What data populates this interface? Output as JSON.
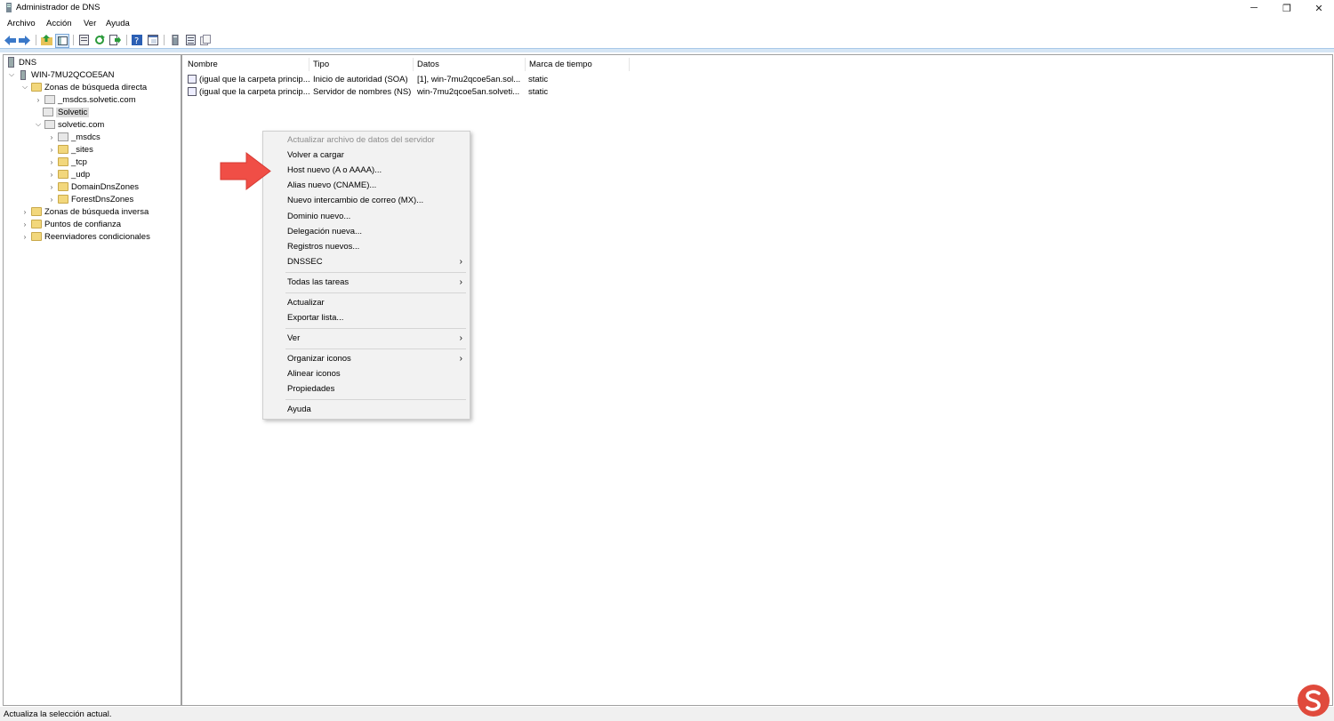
{
  "window": {
    "title": "Administrador de DNS",
    "controls": {
      "minimize": "─",
      "restore": "❐",
      "close": "✕"
    }
  },
  "menu": [
    "Archivo",
    "Acción",
    "Ver",
    "Ayuda"
  ],
  "toolbar": {
    "buttons": [
      "back-icon",
      "forward-icon",
      "up-folder-icon",
      "show-tree-icon",
      "properties-icon",
      "refresh-icon",
      "export-icon",
      "help-icon",
      "console-icon",
      "server-icon",
      "list-icon",
      "records-icon"
    ]
  },
  "tree": {
    "root": "DNS",
    "server": "WIN-7MU2QCOE5AN",
    "forward_zones": "Zonas de búsqueda directa",
    "msdcs_zone": "_msdcs.solvetic.com",
    "solvetic": "Solvetic",
    "solvetic_com": "solvetic.com",
    "children": [
      "_msdcs",
      "_sites",
      "_tcp",
      "_udp",
      "DomainDnsZones",
      "ForestDnsZones"
    ],
    "reverse_zones": "Zonas de búsqueda inversa",
    "trust_points": "Puntos de confianza",
    "conditional_forwarders": "Reenviadores condicionales"
  },
  "list": {
    "columns": [
      "Nombre",
      "Tipo",
      "Datos",
      "Marca de tiempo"
    ],
    "rows": [
      {
        "name": "(igual que la carpeta princip...",
        "type": "Inicio de autoridad (SOA)",
        "data": "[1], win-7mu2qcoe5an.sol...",
        "timestamp": "static"
      },
      {
        "name": "(igual que la carpeta princip...",
        "type": "Servidor de nombres (NS)",
        "data": "win-7mu2qcoe5an.solveti...",
        "timestamp": "static"
      }
    ]
  },
  "context_menu": {
    "update_server_file": "Actualizar archivo de datos del servidor",
    "reload": "Volver a cargar",
    "new_host": "Host nuevo (A o AAAA)...",
    "new_alias": "Alias nuevo (CNAME)...",
    "new_mx": "Nuevo intercambio de correo (MX)...",
    "new_domain": "Dominio nuevo...",
    "new_delegation": "Delegación nueva...",
    "new_records": "Registros nuevos...",
    "dnssec": "DNSSEC",
    "all_tasks": "Todas las tareas",
    "refresh": "Actualizar",
    "export_list": "Exportar lista...",
    "view": "Ver",
    "arrange_icons": "Organizar iconos",
    "align_icons": "Alinear iconos",
    "properties": "Propiedades",
    "help": "Ayuda",
    "submenu_arrow": "›"
  },
  "status_bar": "Actualiza la selección actual.",
  "colors": {
    "annotation_arrow": "#f04e46",
    "watermark": "#e04a3c"
  }
}
